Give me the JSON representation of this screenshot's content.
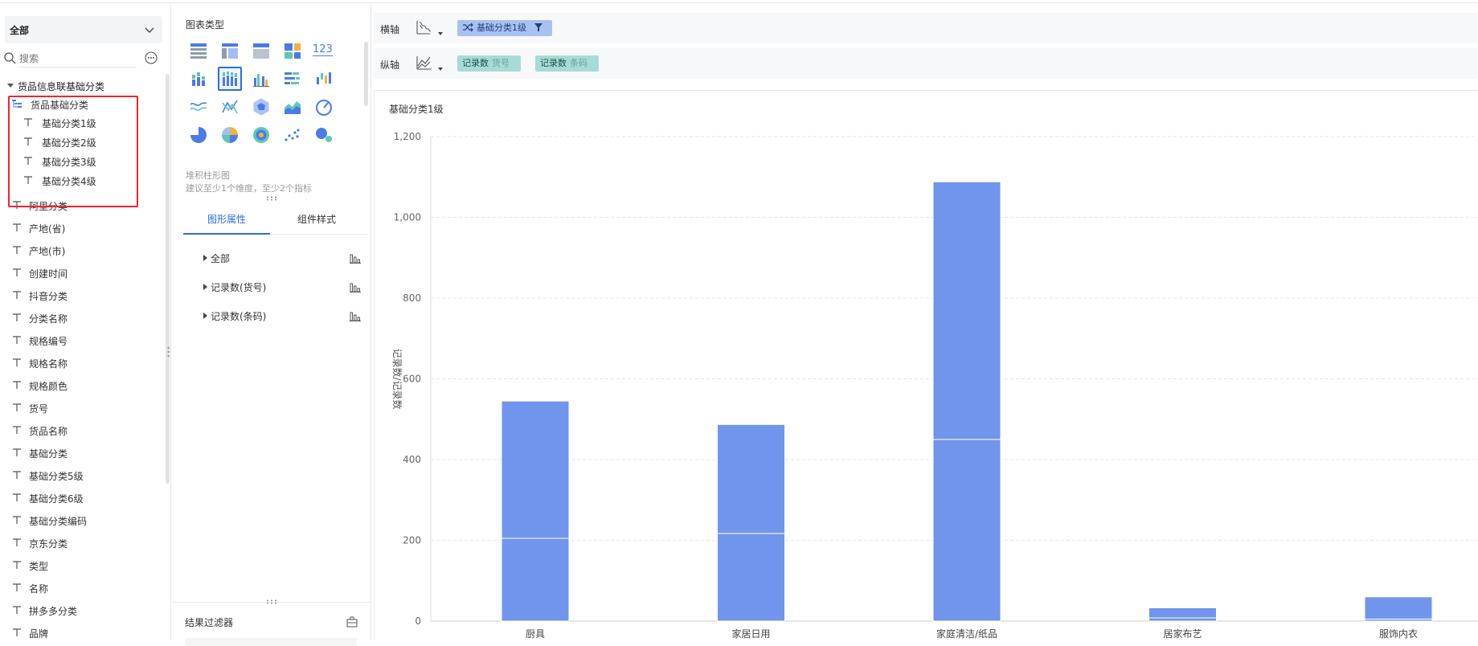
{
  "left_panel": {
    "scope_label": "全部",
    "search_placeholder": "搜索",
    "root_label": "货品信息联基础分类",
    "hierarchy_label": "货品基础分类",
    "hierarchy_children": [
      "基础分类1级",
      "基础分类2级",
      "基础分类3级",
      "基础分类4级"
    ],
    "fields": [
      "阿里分类",
      "产地(省)",
      "产地(市)",
      "创建时间",
      "抖音分类",
      "分类名称",
      "规格编号",
      "规格名称",
      "规格颜色",
      "货号",
      "货品名称",
      "基础分类",
      "基础分类5级",
      "基础分类6级",
      "基础分类编码",
      "京东分类",
      "类型",
      "名称",
      "拼多多分类",
      "品牌"
    ]
  },
  "middle_panel": {
    "chart_types_title": "图表类型",
    "number_chart_label": "123",
    "selected_chart_name": "堆积柱形图",
    "selected_chart_hint": "建议至少1个维度，至少2个指标",
    "tabs": [
      "图形属性",
      "组件样式"
    ],
    "properties": [
      "全部",
      "记录数(货号)",
      "记录数(条码)"
    ],
    "filter_label": "结果过滤器"
  },
  "axes": {
    "x_label": "横轴",
    "y_label": "纵轴",
    "x_field": "基础分类1级",
    "y_fields": [
      {
        "main": "记录数",
        "sub": "货号"
      },
      {
        "main": "记录数",
        "sub": "条码"
      }
    ]
  },
  "colors": {
    "accent": "#2b6de5",
    "bar": "#7194ec",
    "dim_pill": "#a9c0f2",
    "measure_pill": "#a7dcd5",
    "highlight": "#f5222d"
  },
  "chart_data": {
    "type": "bar",
    "stacked": true,
    "title": "基础分类1级",
    "ylabel": "记录数/记录数",
    "xlabel": "基础分类1级",
    "categories": [
      "厨具",
      "家居日用",
      "家庭清洁/纸品",
      "居家布艺",
      "服饰内衣"
    ],
    "series": [
      {
        "values": [
          205,
          217,
          450,
          8,
          5
        ]
      },
      {
        "values": [
          340,
          270,
          638,
          25,
          55
        ]
      }
    ],
    "ylim": [
      0,
      1200
    ],
    "yticks": [
      "0",
      "200",
      "400",
      "600",
      "800",
      "1,000",
      "1,200"
    ],
    "grid": true
  }
}
